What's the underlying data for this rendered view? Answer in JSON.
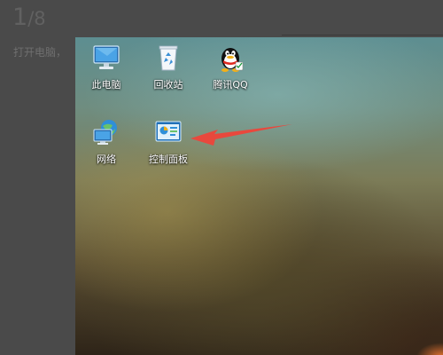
{
  "step": {
    "current": "1",
    "separator": "/",
    "total": "8"
  },
  "instruction": "打开电脑，",
  "desktop": {
    "icons": [
      {
        "label": "此电脑",
        "icon": "this-pc-icon"
      },
      {
        "label": "回收站",
        "icon": "recycle-bin-icon"
      },
      {
        "label": "腾讯QQ",
        "icon": "qq-icon"
      },
      {
        "label": "网络",
        "icon": "network-icon"
      },
      {
        "label": "控制面板",
        "icon": "control-panel-icon"
      }
    ]
  },
  "colors": {
    "annotation_arrow": "#e8483d",
    "page_bg": "#4a4a4a"
  }
}
